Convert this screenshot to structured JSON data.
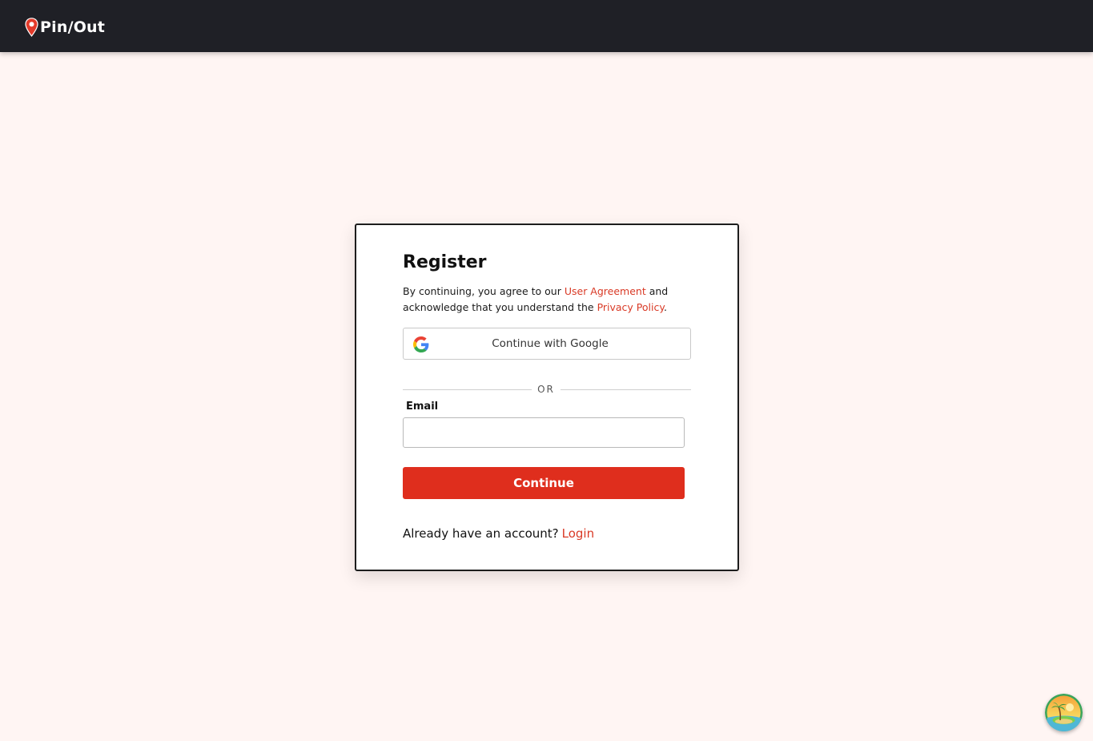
{
  "header": {
    "brand_name": "Pin/Out",
    "brand_icon": "map-pin-icon",
    "brand_color": "#1f2026"
  },
  "register": {
    "title": "Register",
    "legal_prefix": "By continuing, you agree to our ",
    "user_agreement_link": "User Agreement",
    "legal_middle": " and acknowledge that you understand the ",
    "privacy_policy_link": "Privacy Policy",
    "legal_suffix": ".",
    "google_button_label": "Continue with Google",
    "divider_text": "OR",
    "email_label": "Email",
    "email_value": "",
    "continue_button_label": "Continue",
    "already_text": "Already have an account?",
    "login_link": "Login"
  },
  "colors": {
    "accent": "#df2e1d",
    "link": "#d93a26",
    "background": "#fff5f3"
  },
  "floating": {
    "avatar_icon": "tropical-island-icon"
  }
}
